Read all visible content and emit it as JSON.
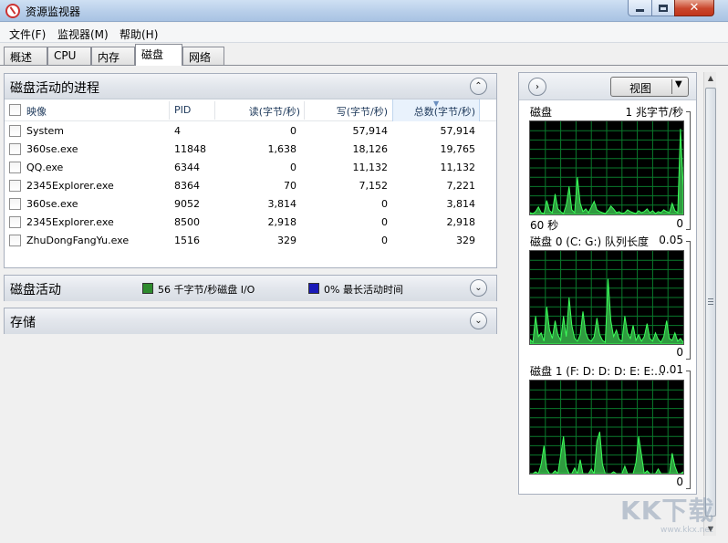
{
  "window": {
    "title": "资源监视器"
  },
  "menu": [
    "文件(F)",
    "监视器(M)",
    "帮助(H)"
  ],
  "tabs": [
    "概述",
    "CPU",
    "内存",
    "磁盘",
    "网络"
  ],
  "active_tab_index": 3,
  "process_panel": {
    "title": "磁盘活动的进程",
    "columns": [
      "映像",
      "PID",
      "读(字节/秒)",
      "写(字节/秒)",
      "总数(字节/秒)"
    ],
    "sorted_column": "总数(字节/秒)",
    "rows": [
      {
        "image": "System",
        "pid": "4",
        "read": "0",
        "write": "57,914",
        "total": "57,914"
      },
      {
        "image": "360se.exe",
        "pid": "11848",
        "read": "1,638",
        "write": "18,126",
        "total": "19,765"
      },
      {
        "image": "QQ.exe",
        "pid": "6344",
        "read": "0",
        "write": "11,132",
        "total": "11,132"
      },
      {
        "image": "2345Explorer.exe",
        "pid": "8364",
        "read": "70",
        "write": "7,152",
        "total": "7,221"
      },
      {
        "image": "360se.exe",
        "pid": "9052",
        "read": "3,814",
        "write": "0",
        "total": "3,814"
      },
      {
        "image": "2345Explorer.exe",
        "pid": "8500",
        "read": "2,918",
        "write": "0",
        "total": "2,918"
      },
      {
        "image": "ZhuDongFangYu.exe",
        "pid": "1516",
        "read": "329",
        "write": "0",
        "total": "329"
      }
    ]
  },
  "disk_activity_panel": {
    "title": "磁盘活动",
    "io_text": "56 千字节/秒磁盘 I/O",
    "io_color": "#2e8b2e",
    "active_text": "0% 最长活动时间",
    "active_color": "#1a1ab8"
  },
  "storage_panel": {
    "title": "存储"
  },
  "right_pane": {
    "view_label": "视图",
    "graphs": [
      {
        "label": "磁盘",
        "scale": "1 兆字节/秒",
        "time": "60 秒",
        "min": "0",
        "values": [
          2,
          1,
          3,
          8,
          2,
          1,
          15,
          4,
          2,
          22,
          6,
          3,
          1,
          10,
          30,
          5,
          2,
          40,
          12,
          3,
          6,
          2,
          8,
          14,
          5,
          3,
          2,
          1,
          4,
          9,
          6,
          2,
          3,
          1,
          2,
          5,
          3,
          2,
          1,
          4,
          2,
          3,
          6,
          2,
          4,
          1,
          3,
          2,
          5,
          3,
          2,
          12,
          4,
          2,
          92,
          30
        ]
      },
      {
        "label": "磁盘 0 (C: G:) 队列长度",
        "scale": "0.05",
        "time": "",
        "min": "0",
        "values": [
          5,
          2,
          30,
          8,
          12,
          3,
          40,
          15,
          6,
          25,
          10,
          4,
          30,
          8,
          50,
          20,
          6,
          3,
          10,
          35,
          12,
          5,
          3,
          8,
          28,
          10,
          4,
          2,
          70,
          25,
          8,
          15,
          5,
          3,
          30,
          12,
          6,
          20,
          4,
          10,
          3,
          8,
          22,
          6,
          3,
          12,
          5,
          2,
          8,
          25,
          6,
          4,
          12,
          3,
          6,
          2
        ]
      },
      {
        "label": "磁盘 1 (F: D: D: D: E: E:...",
        "scale": "0.01",
        "time": "",
        "min": "0",
        "values": [
          0,
          0,
          2,
          0,
          10,
          30,
          5,
          0,
          0,
          3,
          0,
          20,
          40,
          8,
          0,
          0,
          6,
          0,
          15,
          0,
          0,
          0,
          5,
          0,
          35,
          45,
          10,
          0,
          0,
          0,
          2,
          0,
          0,
          0,
          8,
          0,
          0,
          0,
          12,
          40,
          20,
          0,
          3,
          0,
          0,
          0,
          5,
          0,
          0,
          0,
          0,
          22,
          8,
          0,
          0,
          2
        ]
      }
    ]
  },
  "watermark": {
    "main": "KK下载",
    "sub": "www.kkx.net"
  }
}
